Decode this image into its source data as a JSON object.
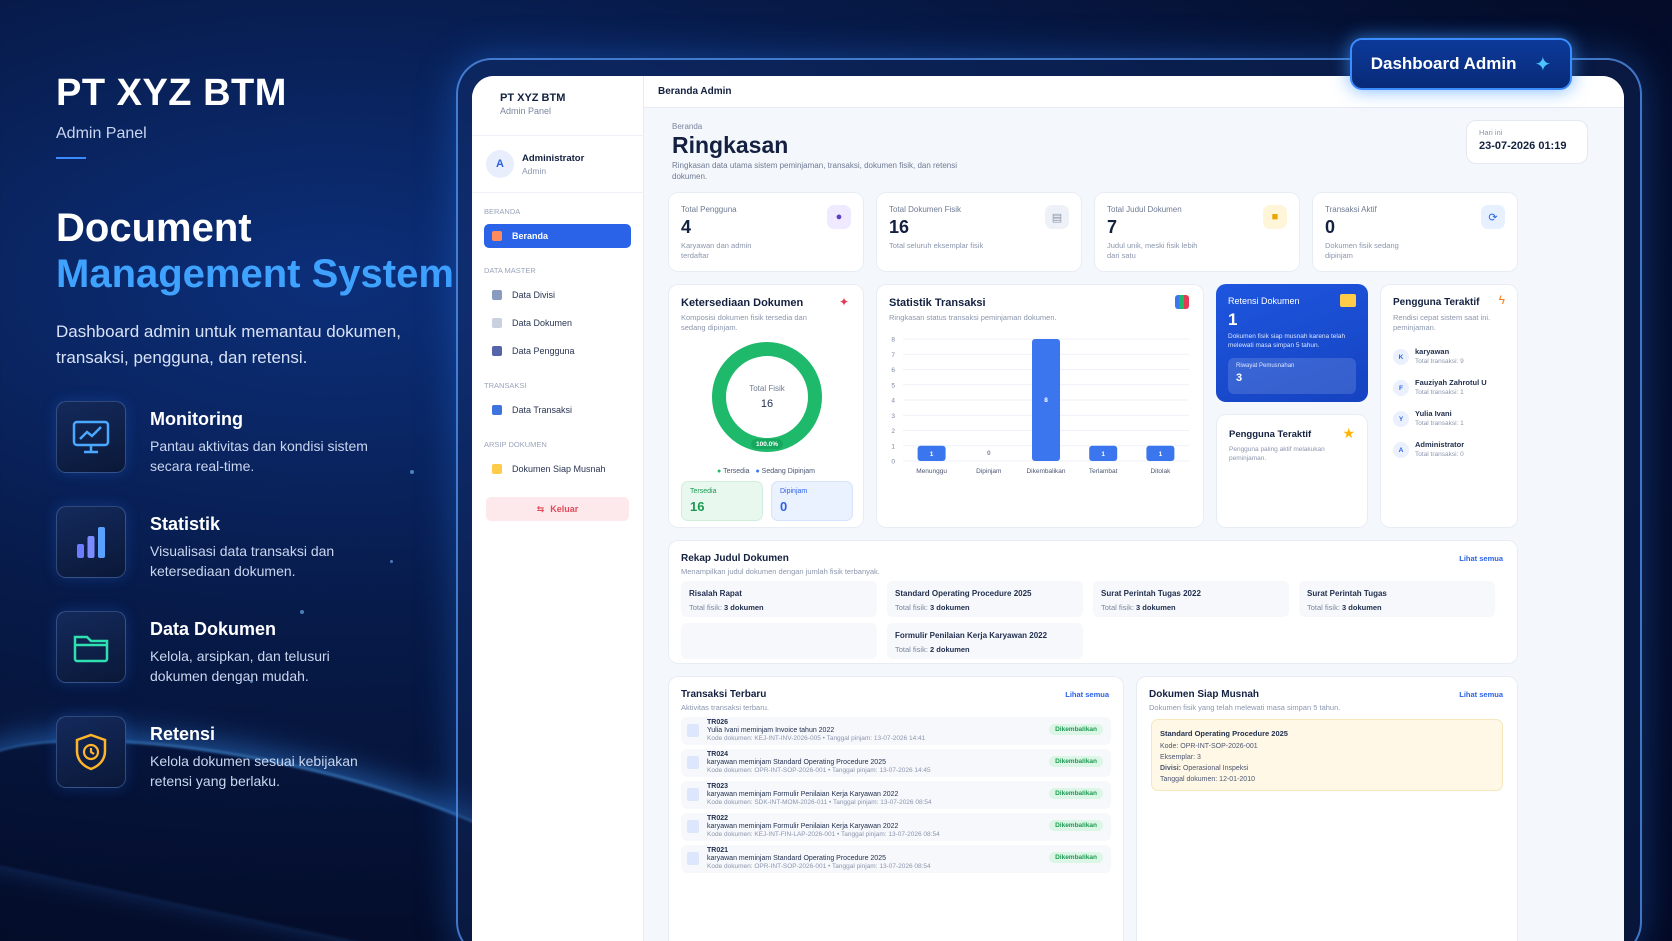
{
  "brand": {
    "title": "PT XYZ BTM",
    "subtitle": "Admin Panel"
  },
  "headline": {
    "line1": "Document",
    "line2": "Management System"
  },
  "lead": "Dashboard admin untuk memantau dokumen, transaksi, pengguna, dan retensi.",
  "features": [
    {
      "icon": "monitor-chart-icon",
      "title": "Monitoring",
      "desc": "Pantau aktivitas dan kondisi sistem secara real-time."
    },
    {
      "icon": "bar-chart-icon",
      "title": "Statistik",
      "desc": "Visualisasi data transaksi dan ketersediaan dokumen."
    },
    {
      "icon": "folder-icon",
      "title": "Data Dokumen",
      "desc": "Kelola, arsipkan, dan telusuri dokumen dengan mudah."
    },
    {
      "icon": "shield-clock-icon",
      "title": "Retensi",
      "desc": "Kelola dokumen sesuai kebijakan retensi yang berlaku."
    }
  ],
  "badge": {
    "label": "Dashboard Admin",
    "icon": "sparkle-icon"
  },
  "app": {
    "sidebar": {
      "brand_title": "PT XYZ BTM",
      "brand_sub": "Admin Panel",
      "user_initial": "A",
      "user_name": "Administrator",
      "user_role": "Admin",
      "sections": {
        "beranda": "BERANDA",
        "master": "DATA MASTER",
        "transaksi": "TRANSAKSI",
        "arsip": "ARSIP DOKUMEN"
      },
      "items": {
        "beranda": "Beranda",
        "divisi": "Data Divisi",
        "dokumen": "Data Dokumen",
        "pengguna": "Data Pengguna",
        "transaksi": "Data Transaksi",
        "musnah": "Dokumen Siap Musnah"
      },
      "logout": "Keluar"
    },
    "topbar_title": "Beranda Admin",
    "breadcrumb": "Beranda",
    "page_title": "Ringkasan",
    "page_desc": "Ringkasan data utama sistem peminjaman, transaksi, dokumen fisik, dan retensi dokumen.",
    "today": {
      "label": "Hari ini",
      "value": "23-07-2026 01:19"
    },
    "stats": [
      {
        "label": "Total Pengguna",
        "value": "4",
        "desc": "Karyawan dan admin terdaftar",
        "icon": "user-icon",
        "color": "#efeaff"
      },
      {
        "label": "Total Dokumen Fisik",
        "value": "16",
        "desc": "Total seluruh eksemplar fisik",
        "icon": "document-icon",
        "color": "#eef2f8"
      },
      {
        "label": "Total Judul Dokumen",
        "value": "7",
        "desc": "Judul unik, meski fisik lebih dari satu",
        "icon": "folder-icon",
        "color": "#fff5d9"
      },
      {
        "label": "Transaksi Aktif",
        "value": "0",
        "desc": "Dokumen fisik sedang dipinjam",
        "icon": "refresh-icon",
        "color": "#e6f0ff"
      }
    ],
    "ketersediaan": {
      "title": "Ketersediaan Dokumen",
      "sub": "Komposisi dokumen fisik tersedia dan sedang dipinjam.",
      "center_label": "Total Fisik",
      "center_value": "16",
      "percent_label": "100.0%",
      "legend_tersedia": "Tersedia",
      "legend_dipinjam": "Sedang Dipinjam",
      "tersedia_label": "Tersedia",
      "tersedia_value": "16",
      "dipinjam_label": "Dipinjam",
      "dipinjam_value": "0"
    },
    "statistik": {
      "title": "Statistik Transaksi",
      "sub": "Ringkasan status transaksi peminjaman dokumen."
    },
    "retensi": {
      "title": "Retensi Dokumen",
      "value": "1",
      "desc": "Dokumen fisik siap musnah karena telah melewati masa simpan 5 tahun.",
      "riwayat_label": "Riwayat Pemusnahan",
      "riwayat_value": "3"
    },
    "pengguna_teraktif_small": {
      "title": "Pengguna Teraktif",
      "desc": "Pengguna paling aktif melakukan peminjaman."
    },
    "pengguna_teraktif": {
      "title": "Pengguna Teraktif",
      "sub": "Rendisi cepat sistem saat ini.",
      "sub2": "peminjaman.",
      "users": [
        {
          "initial": "K",
          "name": "karyawan",
          "total": "Total transaksi: 9"
        },
        {
          "initial": "F",
          "name": "Fauziyah Zahrotul U",
          "total": "Total transaksi: 1"
        },
        {
          "initial": "Y",
          "name": "Yulia Ivani",
          "total": "Total transaksi: 1"
        },
        {
          "initial": "A",
          "name": "Administrator",
          "total": "Total transaksi: 0"
        }
      ]
    },
    "rekap": {
      "title": "Rekap Judul Dokumen",
      "sub": "Menampilkan judul dokumen dengan jumlah fisik terbanyak.",
      "link": "Lihat semua",
      "items": [
        {
          "title": "Risalah Rapat",
          "prefix": "Total fisik:",
          "count": "3 dokumen"
        },
        {
          "title": "Standard Operating Procedure 2025",
          "prefix": "Total fisik:",
          "count": "3 dokumen"
        },
        {
          "title": "Surat Perintah Tugas 2022",
          "prefix": "Total fisik:",
          "count": "3 dokumen"
        },
        {
          "title": "Surat Perintah Tugas",
          "prefix": "Total fisik:",
          "count": "3 dokumen"
        },
        {
          "title": "Formulir Penilaian Kerja Karyawan 2022",
          "prefix": "Total fisik:",
          "count": "2 dokumen"
        }
      ]
    },
    "transaksi": {
      "title": "Transaksi Terbaru",
      "sub": "Aktivitas transaksi terbaru.",
      "link": "Lihat semua",
      "items": [
        {
          "code": "TR026",
          "text": "Yulia Ivani meminjam Invoice tahun 2022",
          "meta": "Kode dokumen: KEJ-INT-INV-2026-005  •  Tanggal pinjam: 13-07-2026 14:41",
          "status": "Dikembalikan"
        },
        {
          "code": "TR024",
          "text": "karyawan meminjam Standard Operating Procedure 2025",
          "meta": "Kode dokumen: OPR-INT-SOP-2026-001  •  Tanggal pinjam: 13-07-2026 14:45",
          "status": "Dikembalikan"
        },
        {
          "code": "TR023",
          "text": "karyawan meminjam Formulir Penilaian Kerja Karyawan 2022",
          "meta": "Kode dokumen: SDK-INT-MOM-2026-011  •  Tanggal pinjam: 13-07-2026 08:54",
          "status": "Dikembalikan"
        },
        {
          "code": "TR022",
          "text": "karyawan meminjam Formulir Penilaian Kerja Karyawan 2022",
          "meta": "Kode dokumen: KEJ-INT-FIN-LAP-2026-001  •  Tanggal pinjam: 13-07-2026 08:54",
          "status": "Dikembalikan"
        },
        {
          "code": "TR021",
          "text": "karyawan meminjam Standard Operating Procedure 2025",
          "meta": "Kode dokumen: OPR-INT-SOP-2026-001  •  Tanggal pinjam: 13-07-2026 08:54",
          "status": "Dikembalikan"
        }
      ]
    },
    "musnah": {
      "title": "Dokumen Siap Musnah",
      "sub": "Dokumen fisik yang telah melewati masa simpan 5 tahun.",
      "link": "Lihat semua",
      "doc_title": "Standard Operating Procedure 2025",
      "kode_label": "Kode:",
      "kode": "OPR-INT-SOP-2026-001",
      "eks_label": "Eksemplar:",
      "eks": "3",
      "divisi_label": "Divisi:",
      "divisi": "Operasional Inspeksi",
      "tanggal_label": "Tanggal dokumen:",
      "tanggal": "12-01-2010"
    }
  },
  "chart_data": {
    "type": "bar",
    "categories": [
      "Menunggu",
      "Dipinjam",
      "Dikembalikan",
      "Terlambat",
      "Ditolak"
    ],
    "values": [
      1,
      0,
      8,
      1,
      1
    ],
    "ylim": [
      0,
      8
    ],
    "yticks": [
      "0",
      "1",
      "2",
      "3",
      "4",
      "5",
      "6",
      "7",
      "8"
    ],
    "color": "#3b76ef"
  },
  "donut_data": {
    "type": "pie",
    "categories": [
      "Tersedia",
      "Sedang Dipinjam"
    ],
    "values": [
      16,
      0
    ],
    "colors": [
      "#1fb96b",
      "#3b76ef"
    ]
  }
}
